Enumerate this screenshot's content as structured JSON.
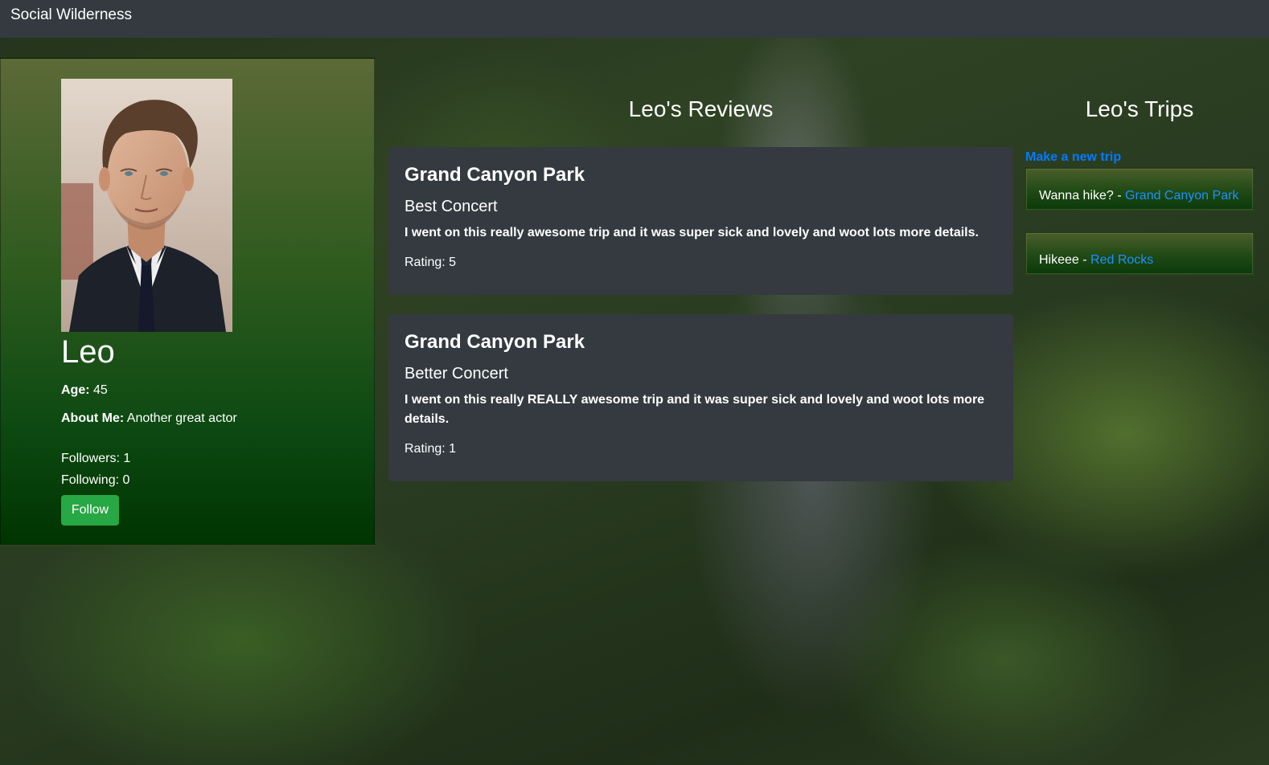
{
  "navbar": {
    "brand": "Social Wilderness"
  },
  "profile": {
    "name": "Leo",
    "age_label": "Age:",
    "age_value": "45",
    "about_label": "About Me:",
    "about_value": "Another great actor",
    "followers": "Followers: 1",
    "following": "Following: 0",
    "follow_button": "Follow",
    "avatar_alt": "Leo"
  },
  "reviews": {
    "heading": "Leo's Reviews",
    "items": [
      {
        "park": "Grand Canyon Park",
        "title": "Best Concert",
        "body": "I went on this really awesome trip and it was super sick and lovely and woot lots more details.",
        "rating": "Rating: 5"
      },
      {
        "park": "Grand Canyon Park",
        "title": "Better Concert",
        "body": "I went on this really REALLY awesome trip and it was super sick and lovely and woot lots more details.",
        "rating": "Rating: 1"
      }
    ]
  },
  "trips": {
    "heading": "Leo's Trips",
    "new_trip_link": "Make a new trip",
    "items": [
      {
        "name": "Wanna hike?",
        "separator": " - ",
        "park": "Grand Canyon Park"
      },
      {
        "name": "Hikeee",
        "separator": " - ",
        "park": "Red Rocks"
      }
    ]
  },
  "colors": {
    "navbar_bg": "#343a40",
    "card_bg": "#343a40",
    "follow_button": "#28a745",
    "link": "#007bff"
  }
}
